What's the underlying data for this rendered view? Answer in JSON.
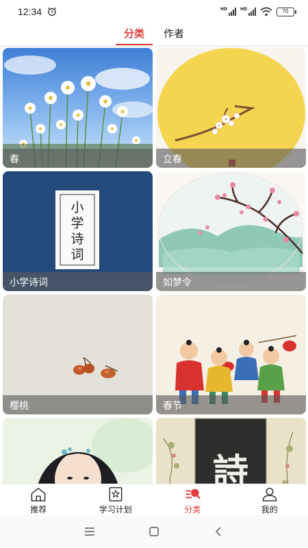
{
  "status_bar": {
    "time": "12:34",
    "battery": "70"
  },
  "tabs": [
    {
      "label": "分类",
      "active": true
    },
    {
      "label": "作者",
      "active": false
    }
  ],
  "cards": [
    {
      "label": "春",
      "image": "daisies-sky"
    },
    {
      "label": "立春",
      "image": "yellow-moon-blossom"
    },
    {
      "label": "小学诗词",
      "image": "book-cover",
      "cover_text": "小学诗词"
    },
    {
      "label": "如梦令",
      "image": "plum-blossom-circle"
    },
    {
      "label": "樱桃",
      "image": "cherries"
    },
    {
      "label": "春节",
      "image": "children-lanterns"
    },
    {
      "label": "",
      "image": "lady-portrait"
    },
    {
      "label": "",
      "image": "poem-calligraphy",
      "calligraphy": "詩"
    }
  ],
  "bottom_nav": [
    {
      "label": "推荐",
      "icon": "home-icon",
      "active": false
    },
    {
      "label": "学习计划",
      "icon": "star-book-icon",
      "active": false
    },
    {
      "label": "分类",
      "icon": "category-icon",
      "active": true
    },
    {
      "label": "我的",
      "icon": "person-icon",
      "active": false
    }
  ],
  "colors": {
    "accent": "#e23a3a",
    "text": "#222222"
  }
}
